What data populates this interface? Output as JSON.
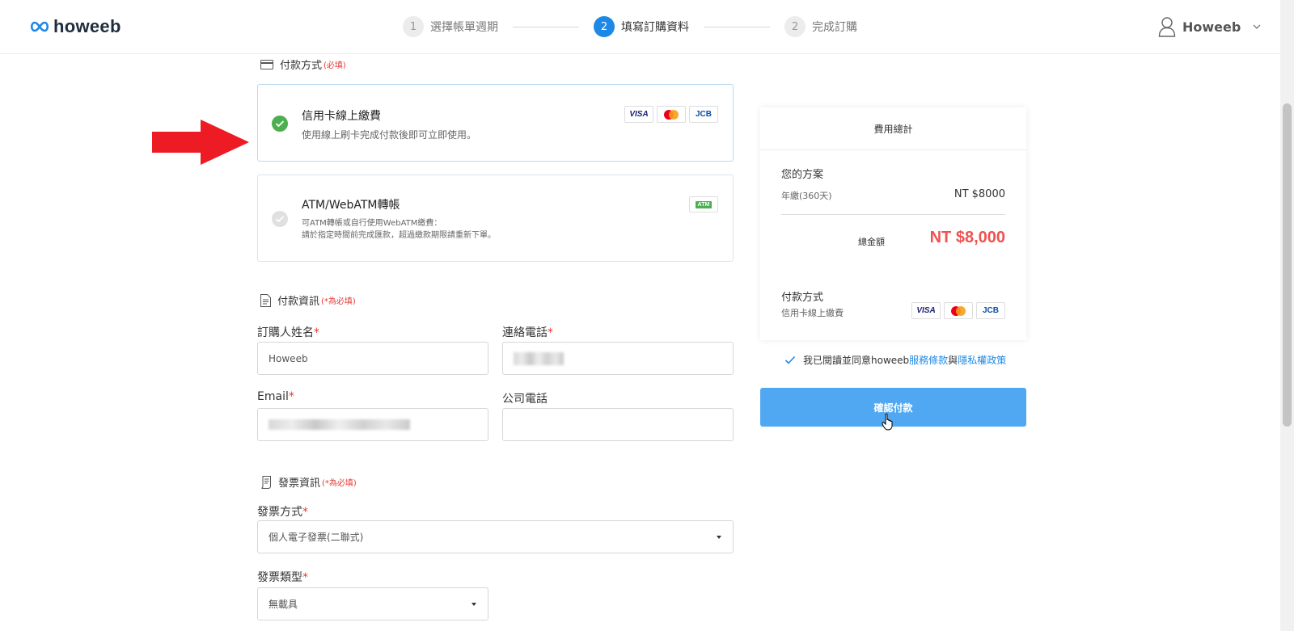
{
  "header": {
    "logo": "howeeb",
    "steps": [
      {
        "num": "1",
        "label": "選擇帳單週期"
      },
      {
        "num": "2",
        "label": "填寫訂購資料"
      },
      {
        "num": "2",
        "label": "完成訂購"
      }
    ],
    "user_name": "Howeeb"
  },
  "payment": {
    "section_title": "付款方式",
    "section_req": "(必填)",
    "options": [
      {
        "title": "信用卡線上繳費",
        "desc": "使用線上刷卡完成付款後即可立即使用。",
        "cards": [
          "VISA",
          "Mastercard",
          "JCB"
        ]
      },
      {
        "title": "ATM/WebATM轉帳",
        "desc_line1": "可ATM轉帳或自行使用WebATM繳費：",
        "desc_line2": "請於指定時間前完成匯款，超過繳款期限請重新下單。",
        "badge": "ATM"
      }
    ]
  },
  "payer": {
    "section_title": "付款資訊",
    "section_req": "(*為必填)",
    "name_label": "訂購人姓名",
    "name_value": "Howeeb",
    "phone_label": "連絡電話",
    "email_label": "Email",
    "company_phone_label": "公司電話"
  },
  "invoice": {
    "section_title": "發票資訊",
    "section_req": "(*為必填)",
    "method_label": "發票方式",
    "method_value": "個人電子發票(二聯式)",
    "type_label": "發票類型",
    "type_value": "無載具"
  },
  "summary": {
    "title": "費用總計",
    "plan_label": "您的方案",
    "plan_name": "年繳(360天)",
    "plan_price": "NT $8000",
    "total_label": "總金額",
    "total_value": "NT $8,000",
    "method_label": "付款方式",
    "method_value": "信用卡線上繳費"
  },
  "agree": {
    "prefix": "我已閱讀並同意howeeb",
    "terms": "服務條款",
    "and": "與",
    "privacy": "隱私權政策"
  },
  "confirm_label": "確認付款",
  "colors": {
    "primary": "#1e88e5",
    "button": "#51a8f2",
    "success": "#4caf50",
    "required": "#e53935",
    "price": "#ef5350",
    "arrow": "#ed1c24"
  }
}
